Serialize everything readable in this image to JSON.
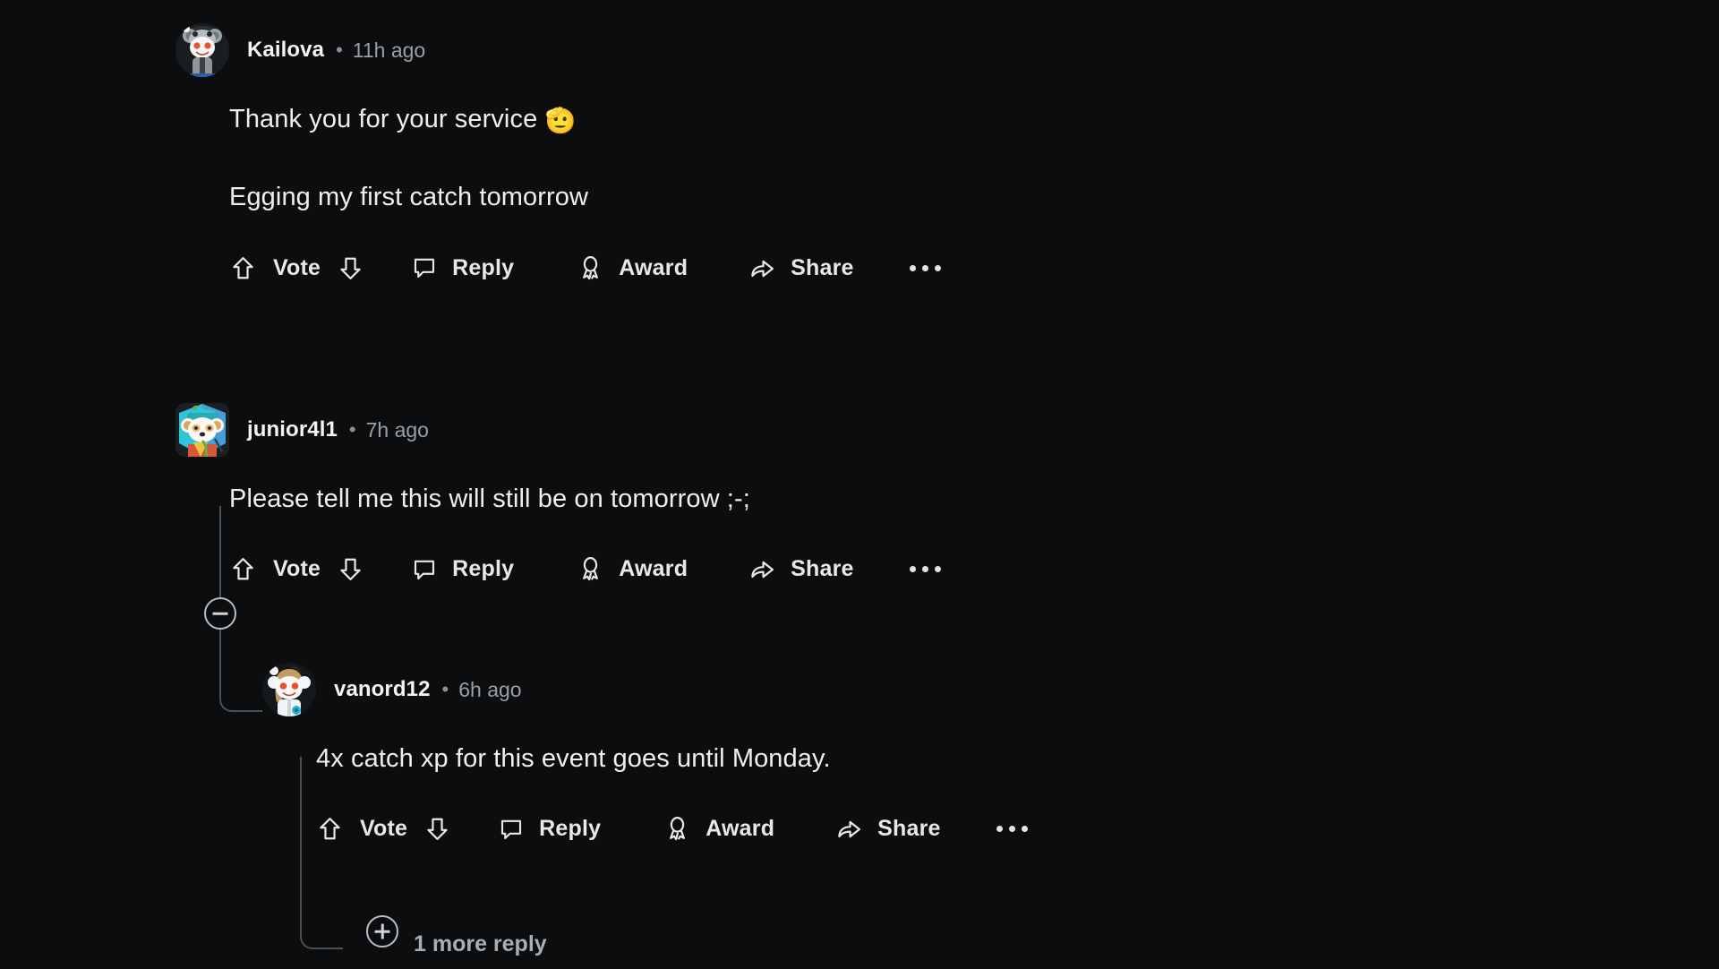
{
  "theme": {
    "background": "#0b0d0e",
    "text_primary": "#edeff0",
    "text_secondary": "#9aa0a5",
    "thread_line": "#4a5054"
  },
  "actions": {
    "vote": "Vote",
    "reply": "Reply",
    "award": "Award",
    "share": "Share",
    "more": "…"
  },
  "comments": [
    {
      "id": "c1",
      "username": "Kailova",
      "separator": "•",
      "timestamp": "11h ago",
      "paragraphs": [
        {
          "text": "Thank you for your service ",
          "emoji": "🫡"
        },
        {
          "text": "Egging my first catch tomorrow",
          "emoji": ""
        }
      ],
      "avatar_kind": "snoo-gray-koala"
    },
    {
      "id": "c2",
      "username": "junior4l1",
      "separator": "•",
      "timestamp": "7h ago",
      "paragraphs": [
        {
          "text": "Please tell me this will still be on tomorrow ;-;",
          "emoji": ""
        }
      ],
      "avatar_kind": "snoo-teal-hex"
    },
    {
      "id": "c3",
      "username": "vanord12",
      "separator": "•",
      "timestamp": "6h ago",
      "paragraphs": [
        {
          "text": "4x catch xp for this event goes until Monday.",
          "emoji": ""
        }
      ],
      "avatar_kind": "snoo-blonde"
    }
  ],
  "more_replies": {
    "label": "1 more reply"
  }
}
